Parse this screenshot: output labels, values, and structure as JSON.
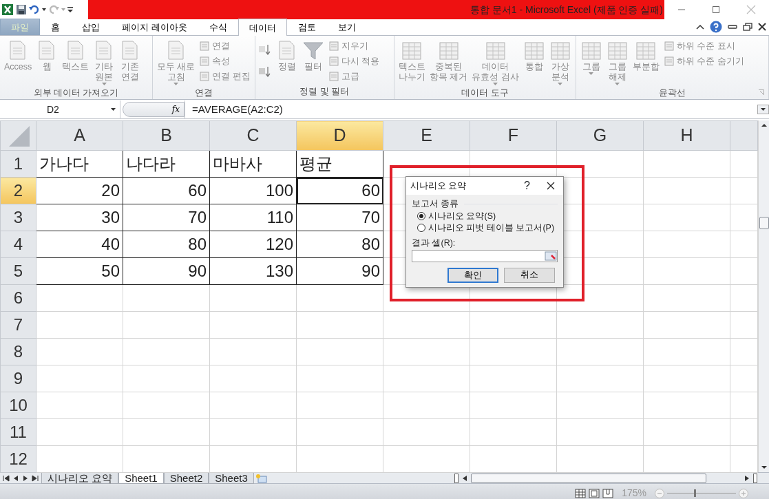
{
  "title_bar": {
    "title": "통합 문서1  -  Microsoft Excel (제품 인증 실패)"
  },
  "ribbon_tabs": [
    {
      "label": "파일",
      "kind": "file",
      "selected": false
    },
    {
      "label": "홈",
      "kind": "tab",
      "selected": false
    },
    {
      "label": "삽입",
      "kind": "tab",
      "selected": false
    },
    {
      "label": "페이지 레이아웃",
      "kind": "tab",
      "selected": false
    },
    {
      "label": "수식",
      "kind": "tab",
      "selected": false
    },
    {
      "label": "데이터",
      "kind": "tab",
      "selected": true
    },
    {
      "label": "검토",
      "kind": "tab",
      "selected": false
    },
    {
      "label": "보기",
      "kind": "tab",
      "selected": false
    }
  ],
  "ribbon_groups": [
    {
      "label": "외부 데이터 가져오기",
      "items": [
        {
          "kind": "large",
          "label": "Access",
          "dropdown": false
        },
        {
          "kind": "large",
          "label": "웹",
          "dropdown": false
        },
        {
          "kind": "large",
          "label": "텍스트",
          "dropdown": false
        },
        {
          "kind": "large",
          "label": "기타\n원본",
          "dropdown": true
        },
        {
          "kind": "large",
          "label": "기존\n연결",
          "dropdown": false
        }
      ]
    },
    {
      "label": "연결",
      "items": [
        {
          "kind": "large",
          "label": "모두 새로\n고침",
          "dropdown": true
        },
        {
          "kind": "stack",
          "items": [
            {
              "label": "연결"
            },
            {
              "label": "속성"
            },
            {
              "label": "연결 편집"
            }
          ]
        }
      ]
    },
    {
      "label": "정렬 및 필터",
      "items": [
        {
          "kind": "sort"
        },
        {
          "kind": "large",
          "label": "정렬",
          "dropdown": false
        },
        {
          "kind": "large",
          "label": "필터",
          "dropdown": false
        },
        {
          "kind": "stack",
          "items": [
            {
              "label": "지우기"
            },
            {
              "label": "다시 적용"
            },
            {
              "label": "고급"
            }
          ]
        }
      ]
    },
    {
      "label": "데이터 도구",
      "items": [
        {
          "kind": "large",
          "label": "텍스트\n나누기",
          "dropdown": false
        },
        {
          "kind": "large",
          "label": "중복된\n항목 제거",
          "dropdown": false
        },
        {
          "kind": "large",
          "label": "데이터\n유효성 검사",
          "dropdown": true
        },
        {
          "kind": "large",
          "label": "통합",
          "dropdown": false
        },
        {
          "kind": "large",
          "label": "가상\n분석",
          "dropdown": true
        }
      ]
    },
    {
      "label": "윤곽선",
      "items": [
        {
          "kind": "large",
          "label": "그룹",
          "dropdown": true
        },
        {
          "kind": "large",
          "label": "그룹\n해제",
          "dropdown": true
        },
        {
          "kind": "large",
          "label": "부분합",
          "dropdown": false
        },
        {
          "kind": "stack",
          "items": [
            {
              "label": "하위 수준 표시"
            },
            {
              "label": "하위 수준 숨기기"
            }
          ]
        }
      ]
    }
  ],
  "formula_bar": {
    "name_box": "D2",
    "function_button": "fx",
    "formula": "=AVERAGE(A2:C2)"
  },
  "sheet": {
    "columns": [
      {
        "label": "A",
        "selected": false
      },
      {
        "label": "B",
        "selected": false
      },
      {
        "label": "C",
        "selected": false
      },
      {
        "label": "D",
        "selected": true
      },
      {
        "label": "E",
        "selected": false
      },
      {
        "label": "F",
        "selected": false
      },
      {
        "label": "G",
        "selected": false
      },
      {
        "label": "H",
        "selected": false
      }
    ],
    "rows": [
      {
        "label": "1",
        "selected": false
      },
      {
        "label": "2",
        "selected": true
      },
      {
        "label": "3",
        "selected": false
      },
      {
        "label": "4",
        "selected": false
      },
      {
        "label": "5",
        "selected": false
      },
      {
        "label": "6",
        "selected": false
      },
      {
        "label": "7",
        "selected": false
      },
      {
        "label": "8",
        "selected": false
      },
      {
        "label": "9",
        "selected": false
      },
      {
        "label": "10",
        "selected": false
      },
      {
        "label": "11",
        "selected": false
      },
      {
        "label": "12",
        "selected": false
      }
    ],
    "cells": [
      [
        "가나다",
        "나다라",
        "마바사",
        "평균"
      ],
      [
        "20",
        "60",
        "100",
        "60"
      ],
      [
        "30",
        "70",
        "110",
        "70"
      ],
      [
        "40",
        "80",
        "120",
        "80"
      ],
      [
        "50",
        "90",
        "130",
        "90"
      ]
    ]
  },
  "sheet_tabs": [
    {
      "label": "시나리오 요약",
      "selected": false
    },
    {
      "label": "Sheet1",
      "selected": true
    },
    {
      "label": "Sheet2",
      "selected": false
    },
    {
      "label": "Sheet3",
      "selected": false
    }
  ],
  "status_bar": {
    "zoom": "175%",
    "zoom_slider": {
      "level": 0.4
    }
  },
  "dialog": {
    "title": "시나리오 요약",
    "help": "?",
    "group_label": "보고서 종류",
    "options": [
      {
        "label": "시나리오 요약(S)",
        "selected": true
      },
      {
        "label": "시나리오 피벗 테이블 보고서(P)",
        "selected": false
      }
    ],
    "result_label": "결과 셀(R):",
    "buttons": [
      {
        "label": "확인",
        "default": true
      },
      {
        "label": "취소",
        "default": false
      }
    ]
  }
}
